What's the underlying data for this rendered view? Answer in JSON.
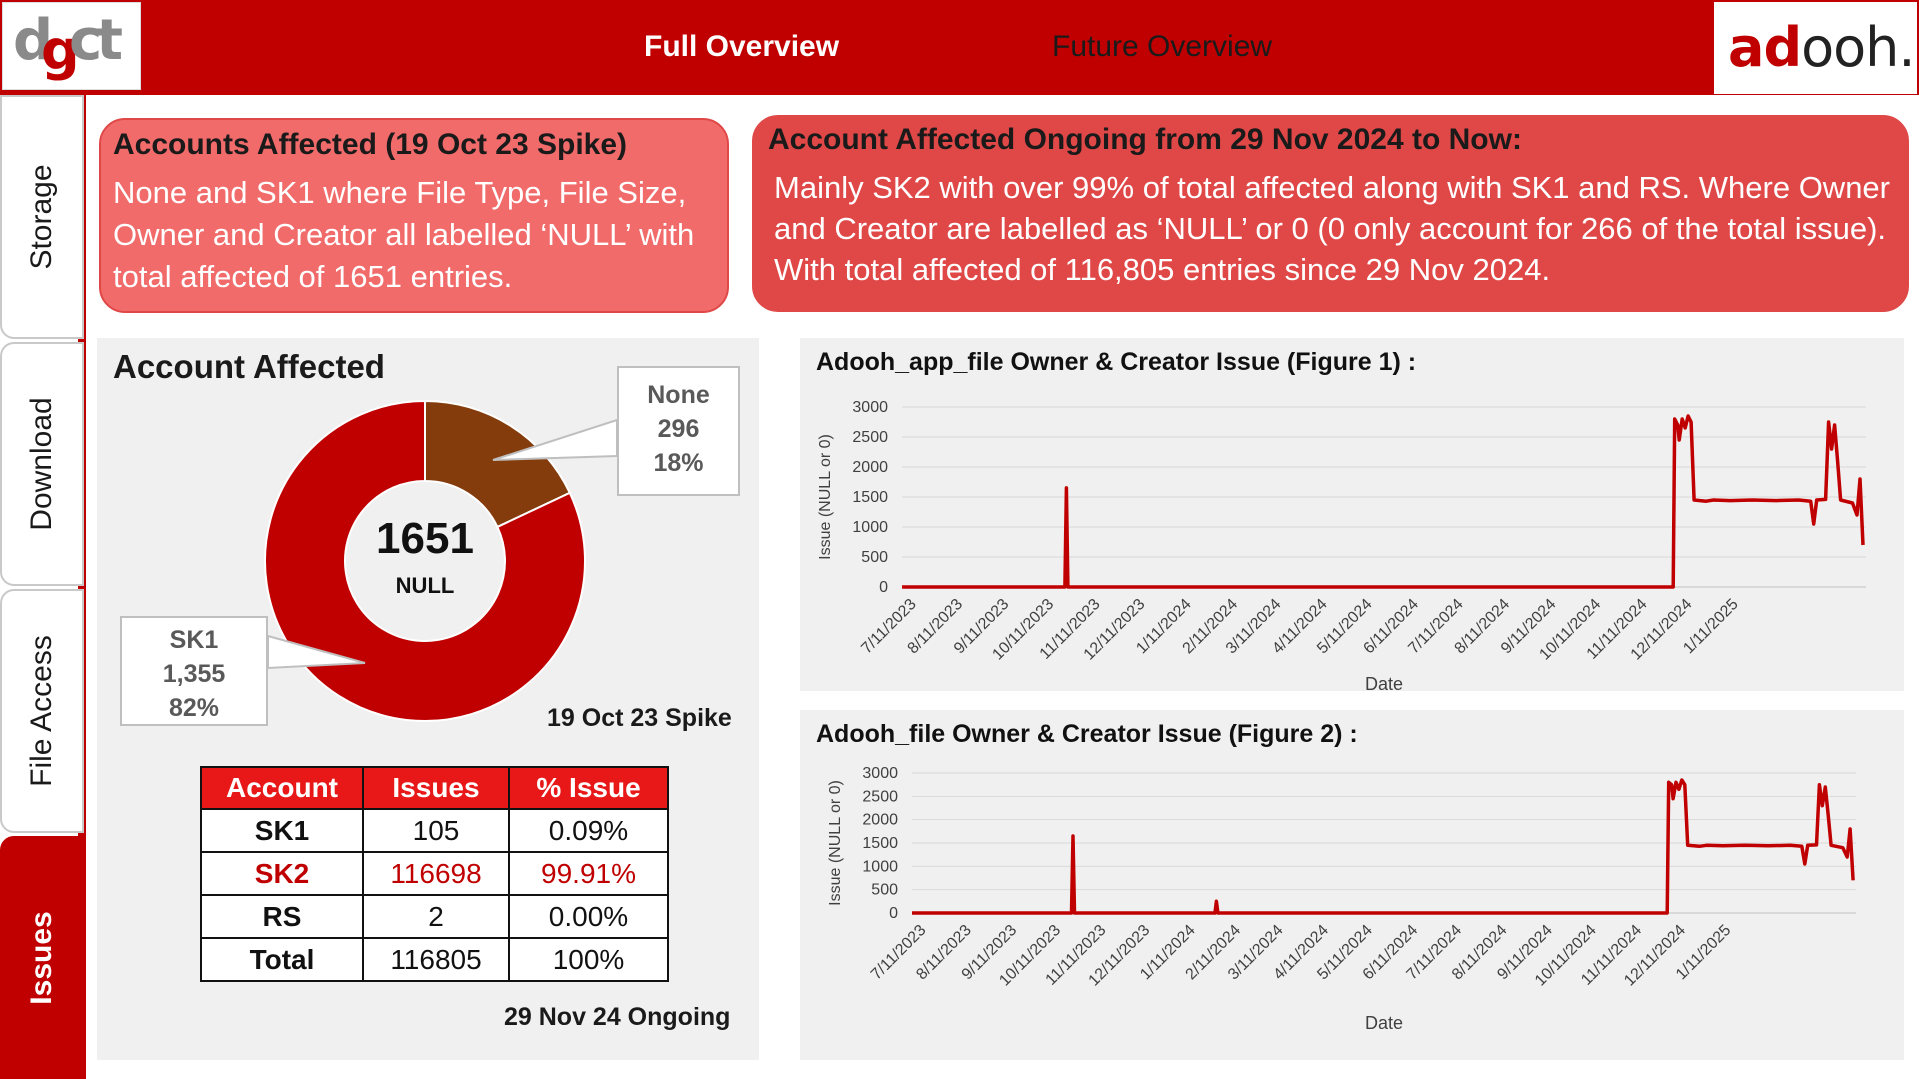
{
  "header": {
    "logo_left": "dgct",
    "logo_right_accent": "ad",
    "logo_right_rest": "ooh.",
    "tabs": [
      {
        "label": "Full Overview",
        "active": true
      },
      {
        "label": "Future Overview",
        "active": false
      }
    ]
  },
  "sidebar": {
    "items": [
      {
        "label": "Storage",
        "active": false
      },
      {
        "label": "Download",
        "active": false
      },
      {
        "label": "File Access",
        "active": false
      },
      {
        "label": "Issues",
        "active": true
      }
    ]
  },
  "callout_spike": {
    "title": "Accounts Affected (19 Oct 23 Spike)",
    "body": "None and SK1 where File Type, File Size, Owner and Creator all labelled ‘NULL’ with total affected of 1651 entries."
  },
  "callout_ongoing": {
    "title": "Account Affected Ongoing from 29 Nov 2024 to Now:",
    "body": "Mainly SK2 with over 99% of total affected along with SK1 and RS. Where Owner and Creator are labelled as ‘NULL’ or 0 (0 only account for 266 of the total issue). With total affected of 116,805 entries since 29 Nov 2024."
  },
  "account_panel": {
    "title": "Account Affected",
    "spike_label": "19 Oct 23 Spike",
    "ongoing_label": "29 Nov 24 Ongoing",
    "donut": {
      "center_value": "1651",
      "center_label": "NULL",
      "slices": [
        {
          "name": "None",
          "value": "296",
          "percent": "18%",
          "fraction": 0.18,
          "color": "#843c0c"
        },
        {
          "name": "SK1",
          "value": "1,355",
          "percent": "82%",
          "fraction": 0.82,
          "color": "#c00000"
        }
      ]
    },
    "table": {
      "headers": [
        "Account",
        "Issues",
        "% Issue"
      ],
      "rows": [
        {
          "account": "SK1",
          "issues": "105",
          "pct": "0.09%",
          "highlight": false
        },
        {
          "account": "SK2",
          "issues": "116698",
          "pct": "99.91%",
          "highlight": true
        },
        {
          "account": "RS",
          "issues": "2",
          "pct": "0.00%",
          "highlight": false
        },
        {
          "account": "Total",
          "issues": "116805",
          "pct": "100%",
          "highlight": false
        }
      ]
    }
  },
  "chart_data": [
    {
      "type": "line",
      "title": "Adooh_app_file Owner & Creator Issue (Figure 1) :",
      "xlabel": "Date",
      "ylabel": "Issue (NULL or 0)",
      "ylim": [
        0,
        3000
      ],
      "yticks": [
        0,
        500,
        1000,
        1500,
        2000,
        2500,
        3000
      ],
      "xticks": [
        "7/11/2023",
        "8/11/2023",
        "9/11/2023",
        "10/11/2023",
        "11/11/2023",
        "12/11/2023",
        "1/11/2024",
        "2/11/2024",
        "3/11/2024",
        "4/11/2024",
        "5/11/2024",
        "6/11/2024",
        "7/11/2024",
        "8/11/2024",
        "9/11/2024",
        "10/11/2024",
        "11/11/2024",
        "12/11/2024",
        "1/11/2025"
      ],
      "grid": true,
      "color": "#c00000",
      "series": [
        {
          "points": [
            [
              "2023-07-01",
              0
            ],
            [
              "2023-10-18",
              0
            ],
            [
              "2023-10-19",
              1651
            ],
            [
              "2023-10-20",
              0
            ],
            [
              "2024-11-28",
              0
            ],
            [
              "2024-11-29",
              2800
            ],
            [
              "2024-12-01",
              2700
            ],
            [
              "2024-12-02",
              2450
            ],
            [
              "2024-12-04",
              2800
            ],
            [
              "2024-12-06",
              2650
            ],
            [
              "2024-12-08",
              2850
            ],
            [
              "2024-12-10",
              2750
            ],
            [
              "2024-12-12",
              1450
            ],
            [
              "2024-12-20",
              1430
            ],
            [
              "2024-12-25",
              1450
            ],
            [
              "2025-01-05",
              1440
            ],
            [
              "2025-01-20",
              1450
            ],
            [
              "2025-02-05",
              1440
            ],
            [
              "2025-02-20",
              1450
            ],
            [
              "2025-02-28",
              1430
            ],
            [
              "2025-03-02",
              1050
            ],
            [
              "2025-03-04",
              1450
            ],
            [
              "2025-03-10",
              1460
            ],
            [
              "2025-03-12",
              2750
            ],
            [
              "2025-03-14",
              2300
            ],
            [
              "2025-03-16",
              2700
            ],
            [
              "2025-03-18",
              2100
            ],
            [
              "2025-03-20",
              1450
            ],
            [
              "2025-03-28",
              1400
            ],
            [
              "2025-03-31",
              1200
            ],
            [
              "2025-04-02",
              1800
            ],
            [
              "2025-04-04",
              700
            ]
          ]
        }
      ]
    },
    {
      "type": "line",
      "title": "Adooh_file Owner & Creator Issue (Figure 2) :",
      "xlabel": "Date",
      "ylabel": "Issue (NULL or 0)",
      "ylim": [
        0,
        3000
      ],
      "yticks": [
        0,
        500,
        1000,
        1500,
        2000,
        2500,
        3000
      ],
      "xticks": [
        "7/11/2023",
        "8/11/2023",
        "9/11/2023",
        "10/11/2023",
        "11/11/2023",
        "12/11/2023",
        "1/11/2024",
        "2/11/2024",
        "3/11/2024",
        "4/11/2024",
        "5/11/2024",
        "6/11/2024",
        "7/11/2024",
        "8/11/2024",
        "9/11/2024",
        "10/11/2024",
        "11/11/2024",
        "12/11/2024",
        "1/11/2025"
      ],
      "grid": true,
      "color": "#c00000",
      "series": [
        {
          "points": [
            [
              "2023-07-01",
              0
            ],
            [
              "2023-10-18",
              0
            ],
            [
              "2023-10-19",
              1651
            ],
            [
              "2023-10-20",
              0
            ],
            [
              "2024-01-24",
              0
            ],
            [
              "2024-01-25",
              250
            ],
            [
              "2024-01-26",
              0
            ],
            [
              "2024-11-28",
              0
            ],
            [
              "2024-11-29",
              2800
            ],
            [
              "2024-12-01",
              2750
            ],
            [
              "2024-12-02",
              2450
            ],
            [
              "2024-12-04",
              2800
            ],
            [
              "2024-12-06",
              2650
            ],
            [
              "2024-12-08",
              2850
            ],
            [
              "2024-12-10",
              2750
            ],
            [
              "2024-12-12",
              1450
            ],
            [
              "2024-12-20",
              1430
            ],
            [
              "2024-12-25",
              1450
            ],
            [
              "2025-01-05",
              1440
            ],
            [
              "2025-01-20",
              1450
            ],
            [
              "2025-02-05",
              1440
            ],
            [
              "2025-02-20",
              1450
            ],
            [
              "2025-02-28",
              1430
            ],
            [
              "2025-03-02",
              1050
            ],
            [
              "2025-03-04",
              1450
            ],
            [
              "2025-03-10",
              1460
            ],
            [
              "2025-03-12",
              2750
            ],
            [
              "2025-03-14",
              2300
            ],
            [
              "2025-03-16",
              2700
            ],
            [
              "2025-03-18",
              2100
            ],
            [
              "2025-03-20",
              1450
            ],
            [
              "2025-03-28",
              1400
            ],
            [
              "2025-03-31",
              1200
            ],
            [
              "2025-04-02",
              1800
            ],
            [
              "2025-04-04",
              700
            ]
          ]
        }
      ]
    }
  ]
}
